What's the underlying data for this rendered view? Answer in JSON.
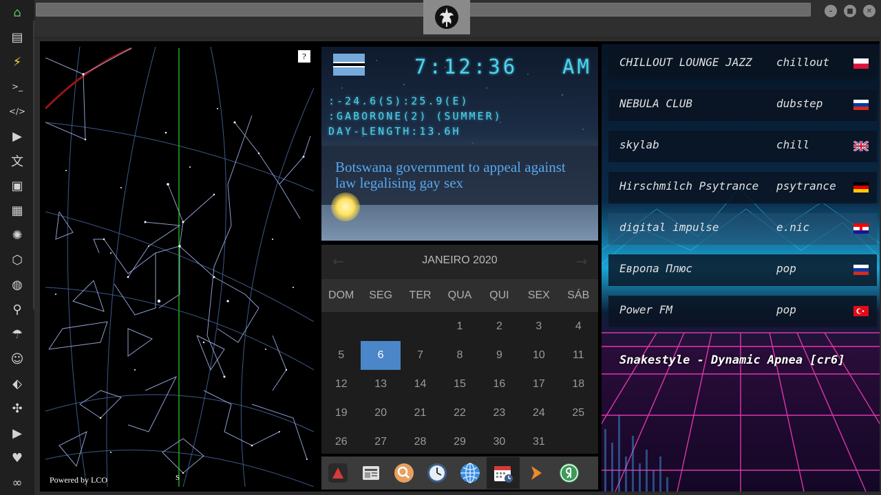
{
  "sidebar": {
    "items": [
      {
        "name": "home-icon",
        "glyph": "⌂"
      },
      {
        "name": "document-icon",
        "glyph": "▤"
      },
      {
        "name": "lightning-icon",
        "glyph": "⚡"
      },
      {
        "name": "terminal-icon",
        "glyph": ">_"
      },
      {
        "name": "code-icon",
        "glyph": "</>"
      },
      {
        "name": "play-icon",
        "glyph": "▶"
      },
      {
        "name": "translate-icon",
        "glyph": "文"
      },
      {
        "name": "image-icon",
        "glyph": "▣"
      },
      {
        "name": "newspaper-icon",
        "glyph": "▦"
      },
      {
        "name": "rebel-alliance-icon",
        "glyph": "✺"
      },
      {
        "name": "hexagon-icon",
        "glyph": "⬡"
      },
      {
        "name": "globe-icon",
        "glyph": "◍"
      },
      {
        "name": "search-icon",
        "glyph": "⚲"
      },
      {
        "name": "umbrella-icon",
        "glyph": "☂"
      },
      {
        "name": "contacts-icon",
        "glyph": "☺"
      },
      {
        "name": "link-icon",
        "glyph": "⬖"
      },
      {
        "name": "fullscreen-icon",
        "glyph": "✣"
      },
      {
        "name": "youtube-icon",
        "glyph": "▶"
      },
      {
        "name": "heart-icon",
        "glyph": "♥"
      },
      {
        "name": "infinity-icon",
        "glyph": "∞"
      }
    ]
  },
  "window": {
    "min_glyph": "–",
    "max_glyph": "■",
    "close_glyph": "✕"
  },
  "starmap": {
    "help_label": "?",
    "credit": "Powered by LCO",
    "direction_label": "S"
  },
  "clock": {
    "time": "7:12:36",
    "ampm": "AM",
    "coords": ":-24.6(S):25.9(E)",
    "timezone": ":GABORONE(2) (SUMMER)",
    "day_length": "DAY-LENGTH:13.6H",
    "headline": "Botswana government to appeal against law legalising gay sex",
    "colors": {
      "digital": "#4fd3ee",
      "headline": "#58a8ee"
    }
  },
  "calendar": {
    "title": "JANEIRO 2020",
    "prev_glyph": "←",
    "next_glyph": "→",
    "weekdays": [
      "DOM",
      "SEG",
      "TER",
      "QUA",
      "QUI",
      "SEX",
      "SÁB"
    ],
    "first_weekday_index": 3,
    "days_in_month": 31,
    "selected_day": 6,
    "selected_color": "#4a86c8"
  },
  "dock": {
    "items": [
      {
        "name": "dock-app-red-triangle-icon",
        "color": "#d83a3a"
      },
      {
        "name": "dock-app-newsreader-icon",
        "color": "#e0e0e0"
      },
      {
        "name": "dock-app-search-icon",
        "color": "#e8a060"
      },
      {
        "name": "dock-app-clock-icon",
        "color": "#3d5f8c"
      },
      {
        "name": "dock-app-globe-icon",
        "color": "#3a8ee0"
      },
      {
        "name": "dock-app-calendar-icon",
        "color": "#d83a3a"
      },
      {
        "name": "dock-app-play-arrow-icon",
        "color": "#f08a28"
      },
      {
        "name": "dock-app-yandex-icon",
        "color": "#3f9a5a"
      }
    ]
  },
  "radio": {
    "stations": [
      {
        "name": "CHILLOUT LOUNGE JAZZ",
        "genre": "chillout",
        "flag": "pl"
      },
      {
        "name": "NEBULA CLUB",
        "genre": "dubstep",
        "flag": "ru"
      },
      {
        "name": "skylab",
        "genre": "chill",
        "flag": "gb"
      },
      {
        "name": "Hirschmilch Psytrance",
        "genre": "psytrance",
        "flag": "de"
      },
      {
        "name": "digital impulse",
        "genre": "e.nic",
        "flag": "hr"
      },
      {
        "name": "Европа Плюс",
        "genre": "pop",
        "flag": "ru"
      },
      {
        "name": "Power FM",
        "genre": "pop",
        "flag": "tr"
      }
    ],
    "now_playing": "Snakestyle - Dynamic Apnea [cr6]",
    "highlighted_index": 4
  }
}
